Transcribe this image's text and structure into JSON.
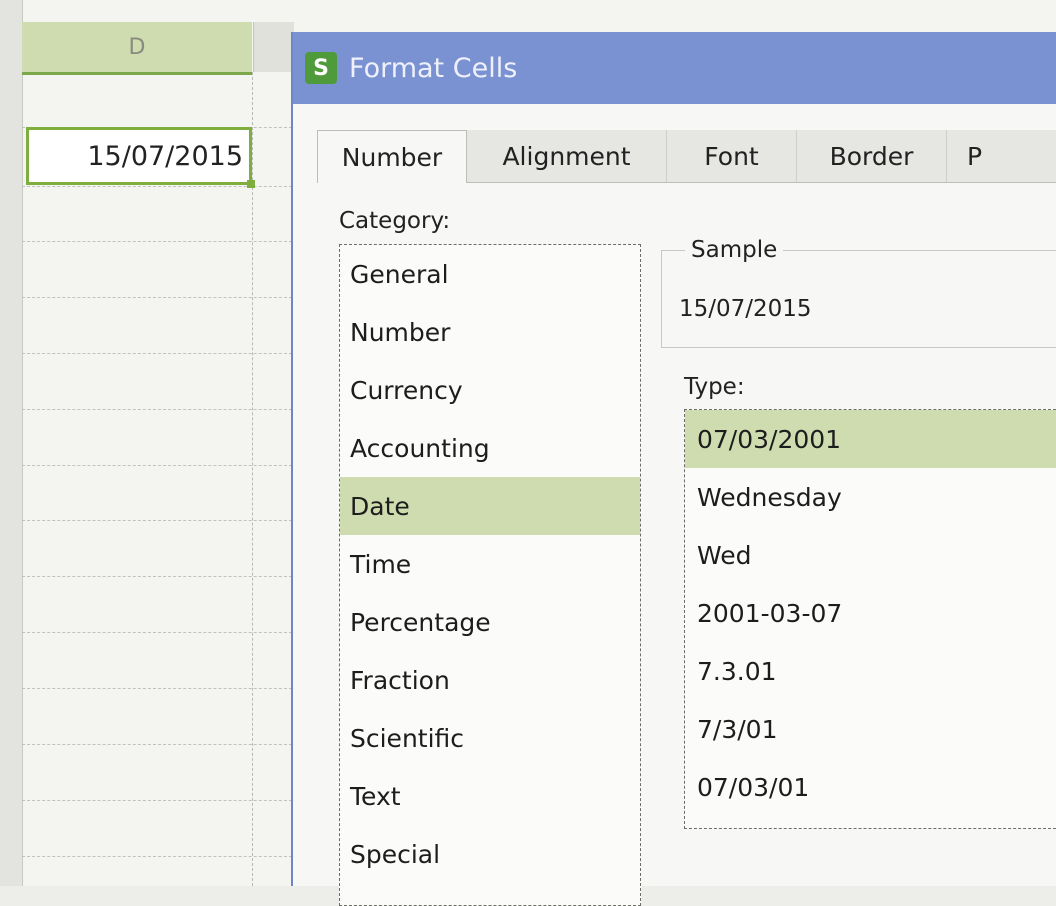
{
  "spreadsheet": {
    "column_header": "D",
    "active_cell_value": "15/07/2015"
  },
  "dialog": {
    "title": "Format Cells",
    "app_icon_letter": "S",
    "tabs": [
      {
        "label": "Number",
        "active": true
      },
      {
        "label": "Alignment",
        "active": false
      },
      {
        "label": "Font",
        "active": false
      },
      {
        "label": "Border",
        "active": false
      },
      {
        "label": "P",
        "active": false
      }
    ],
    "category_label": "Category:",
    "categories": [
      {
        "label": "General",
        "selected": false
      },
      {
        "label": "Number",
        "selected": false
      },
      {
        "label": "Currency",
        "selected": false
      },
      {
        "label": "Accounting",
        "selected": false
      },
      {
        "label": "Date",
        "selected": true
      },
      {
        "label": "Time",
        "selected": false
      },
      {
        "label": "Percentage",
        "selected": false
      },
      {
        "label": "Fraction",
        "selected": false
      },
      {
        "label": "Scientific",
        "selected": false
      },
      {
        "label": "Text",
        "selected": false
      },
      {
        "label": "Special",
        "selected": false
      }
    ],
    "sample_label": "Sample",
    "sample_value": "15/07/2015",
    "type_label": "Type:",
    "types": [
      {
        "label": "07/03/2001",
        "selected": true
      },
      {
        "label": "Wednesday",
        "selected": false
      },
      {
        "label": "Wed",
        "selected": false
      },
      {
        "label": "2001-03-07",
        "selected": false
      },
      {
        "label": "7.3.01",
        "selected": false
      },
      {
        "label": "7/3/01",
        "selected": false
      },
      {
        "label": "07/03/01",
        "selected": false
      }
    ]
  },
  "colors": {
    "selection": "#cfdcb0",
    "active_cell_border": "#7fae3f",
    "titlebar": "#7b92d2"
  }
}
